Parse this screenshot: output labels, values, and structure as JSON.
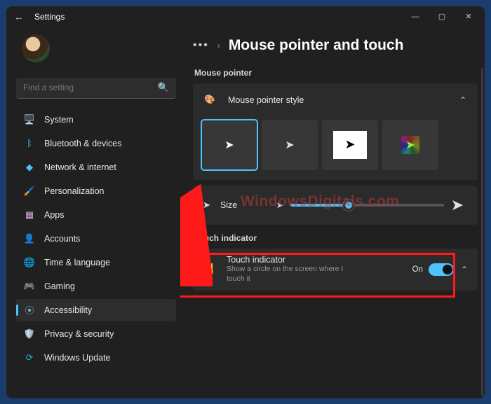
{
  "titlebar": {
    "title": "Settings"
  },
  "search": {
    "placeholder": "Find a setting"
  },
  "sidebar": {
    "items": [
      {
        "label": "System",
        "icon": "🖥️",
        "color": "#4cc2ff"
      },
      {
        "label": "Bluetooth & devices",
        "icon": "ᛒ",
        "color": "#4cc2ff"
      },
      {
        "label": "Network & internet",
        "icon": "◆",
        "color": "#4cc2ff"
      },
      {
        "label": "Personalization",
        "icon": "🖌️",
        "color": "#d08050"
      },
      {
        "label": "Apps",
        "icon": "▦",
        "color": "#cfa6d6"
      },
      {
        "label": "Accounts",
        "icon": "👤",
        "color": "#35c48f"
      },
      {
        "label": "Time & language",
        "icon": "🌐",
        "color": "#4cc2ff"
      },
      {
        "label": "Gaming",
        "icon": "🎮",
        "color": "#a8a8a8"
      },
      {
        "label": "Accessibility",
        "icon": "⦿",
        "color": "#6fb8c9",
        "active": true
      },
      {
        "label": "Privacy & security",
        "icon": "🛡️",
        "color": "#a8a8a8"
      },
      {
        "label": "Windows Update",
        "icon": "⟳",
        "color": "#2e9fd6"
      }
    ]
  },
  "breadcrumb": {
    "page_title": "Mouse pointer and touch"
  },
  "sections": {
    "mouse_pointer_label": "Mouse pointer",
    "style_card_label": "Mouse pointer style",
    "size_label": "Size",
    "touch_section_label": "Touch indicator",
    "touch_card_title": "Touch indicator",
    "touch_card_desc": "Show a circle on the screen where I touch it",
    "touch_on_label": "On"
  },
  "watermark": "WindowsDigitals.com"
}
